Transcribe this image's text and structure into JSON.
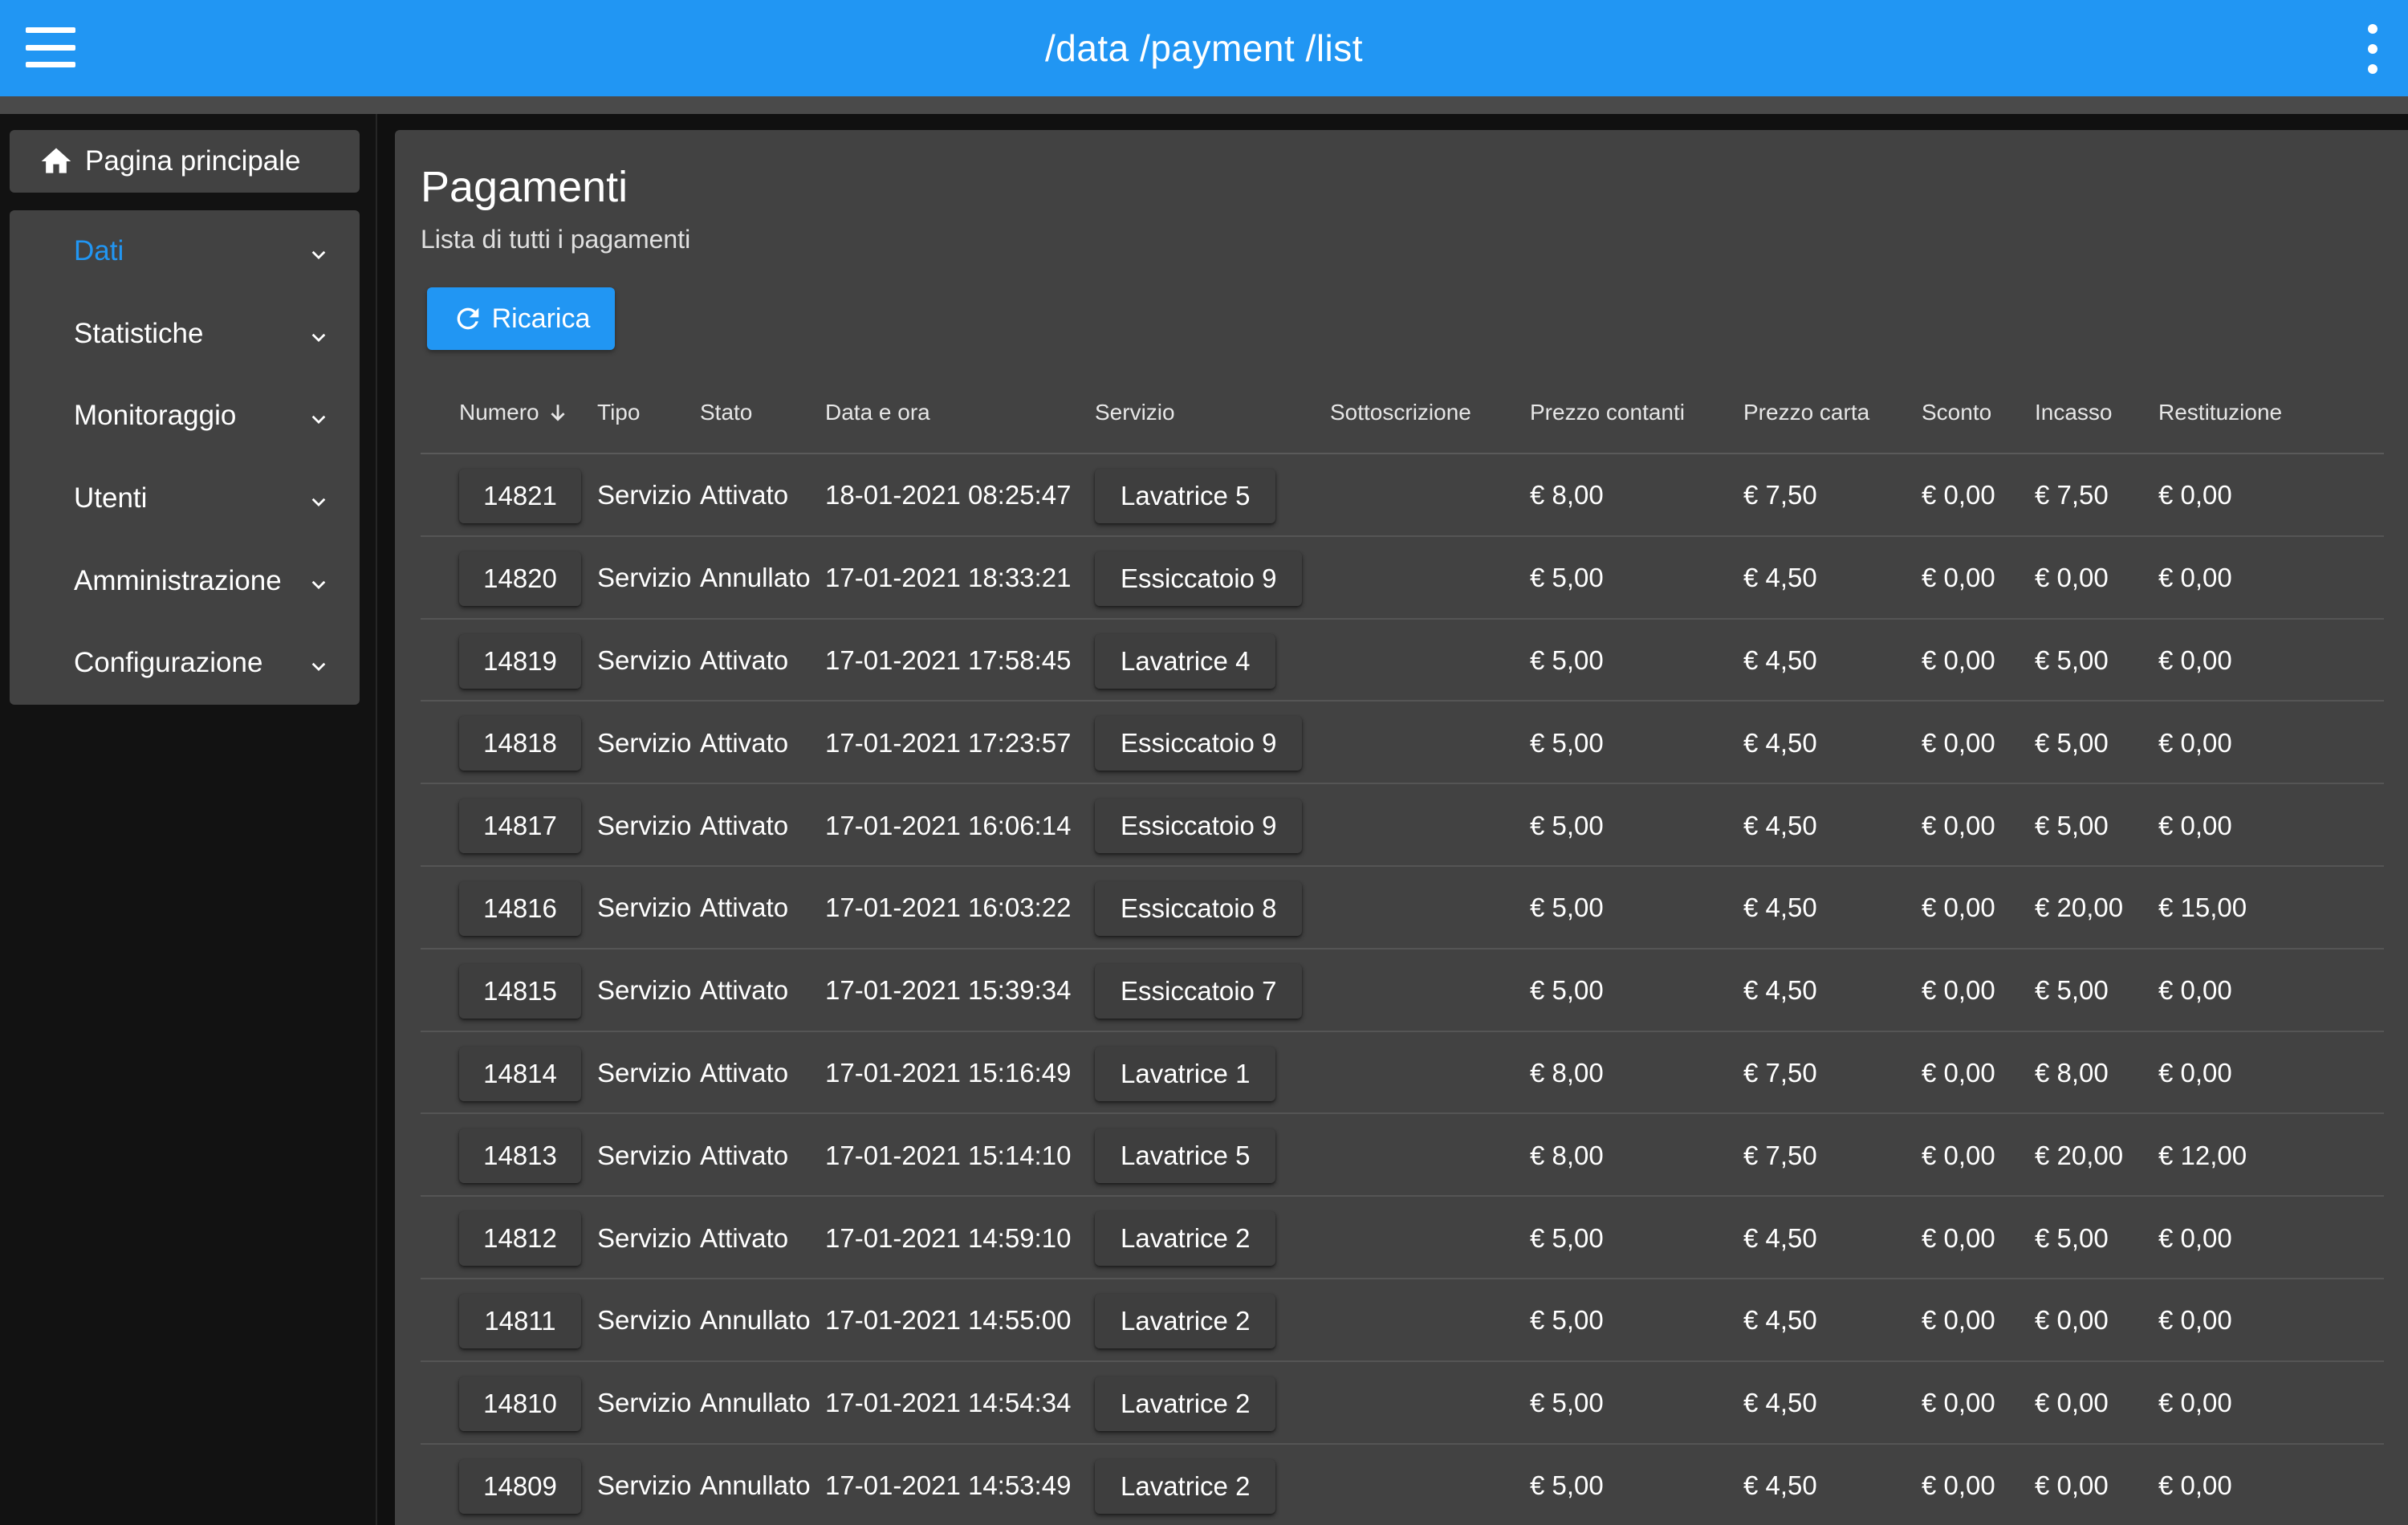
{
  "appbar": {
    "title": "/data /payment /list",
    "menu_icon": "menu-icon",
    "more_icon": "more-vert-icon"
  },
  "sidebar": {
    "home": {
      "label": "Pagina principale",
      "icon": "home-icon"
    },
    "items": [
      {
        "label": "Dati",
        "active": true
      },
      {
        "label": "Statistiche",
        "active": false
      },
      {
        "label": "Monitoraggio",
        "active": false
      },
      {
        "label": "Utenti",
        "active": false
      },
      {
        "label": "Amministrazione",
        "active": false
      },
      {
        "label": "Configurazione",
        "active": false
      }
    ]
  },
  "main": {
    "title": "Pagamenti",
    "subtitle": "Lista di tutti i pagamenti",
    "reload_label": "Ricarica",
    "table": {
      "headers": [
        "Numero",
        "Tipo",
        "Stato",
        "Data e ora",
        "Servizio",
        "Sottoscrizione",
        "Prezzo contanti",
        "Prezzo carta",
        "Sconto",
        "Incasso",
        "Restituzione"
      ],
      "sort_column": "Numero",
      "sort_direction": "desc",
      "rows": [
        [
          "14821",
          "Servizio",
          "Attivato",
          "18-01-2021 08:25:47",
          "Lavatrice 5",
          "",
          "€ 8,00",
          "€ 7,50",
          "€ 0,00",
          "€ 7,50",
          "€ 0,00"
        ],
        [
          "14820",
          "Servizio",
          "Annullato",
          "17-01-2021 18:33:21",
          "Essiccatoio 9",
          "",
          "€ 5,00",
          "€ 4,50",
          "€ 0,00",
          "€ 0,00",
          "€ 0,00"
        ],
        [
          "14819",
          "Servizio",
          "Attivato",
          "17-01-2021 17:58:45",
          "Lavatrice 4",
          "",
          "€ 5,00",
          "€ 4,50",
          "€ 0,00",
          "€ 5,00",
          "€ 0,00"
        ],
        [
          "14818",
          "Servizio",
          "Attivato",
          "17-01-2021 17:23:57",
          "Essiccatoio 9",
          "",
          "€ 5,00",
          "€ 4,50",
          "€ 0,00",
          "€ 5,00",
          "€ 0,00"
        ],
        [
          "14817",
          "Servizio",
          "Attivato",
          "17-01-2021 16:06:14",
          "Essiccatoio 9",
          "",
          "€ 5,00",
          "€ 4,50",
          "€ 0,00",
          "€ 5,00",
          "€ 0,00"
        ],
        [
          "14816",
          "Servizio",
          "Attivato",
          "17-01-2021 16:03:22",
          "Essiccatoio 8",
          "",
          "€ 5,00",
          "€ 4,50",
          "€ 0,00",
          "€ 20,00",
          "€ 15,00"
        ],
        [
          "14815",
          "Servizio",
          "Attivato",
          "17-01-2021 15:39:34",
          "Essiccatoio 7",
          "",
          "€ 5,00",
          "€ 4,50",
          "€ 0,00",
          "€ 5,00",
          "€ 0,00"
        ],
        [
          "14814",
          "Servizio",
          "Attivato",
          "17-01-2021 15:16:49",
          "Lavatrice 1",
          "",
          "€ 8,00",
          "€ 7,50",
          "€ 0,00",
          "€ 8,00",
          "€ 0,00"
        ],
        [
          "14813",
          "Servizio",
          "Attivato",
          "17-01-2021 15:14:10",
          "Lavatrice 5",
          "",
          "€ 8,00",
          "€ 7,50",
          "€ 0,00",
          "€ 20,00",
          "€ 12,00"
        ],
        [
          "14812",
          "Servizio",
          "Attivato",
          "17-01-2021 14:59:10",
          "Lavatrice 2",
          "",
          "€ 5,00",
          "€ 4,50",
          "€ 0,00",
          "€ 5,00",
          "€ 0,00"
        ],
        [
          "14811",
          "Servizio",
          "Annullato",
          "17-01-2021 14:55:00",
          "Lavatrice 2",
          "",
          "€ 5,00",
          "€ 4,50",
          "€ 0,00",
          "€ 0,00",
          "€ 0,00"
        ],
        [
          "14810",
          "Servizio",
          "Annullato",
          "17-01-2021 14:54:34",
          "Lavatrice 2",
          "",
          "€ 5,00",
          "€ 4,50",
          "€ 0,00",
          "€ 0,00",
          "€ 0,00"
        ],
        [
          "14809",
          "Servizio",
          "Annullato",
          "17-01-2021 14:53:49",
          "Lavatrice 2",
          "",
          "€ 5,00",
          "€ 4,50",
          "€ 0,00",
          "€ 0,00",
          "€ 0,00"
        ]
      ]
    }
  },
  "colors": {
    "accent": "#2196f3",
    "surface": "#424242",
    "background": "#101010"
  }
}
